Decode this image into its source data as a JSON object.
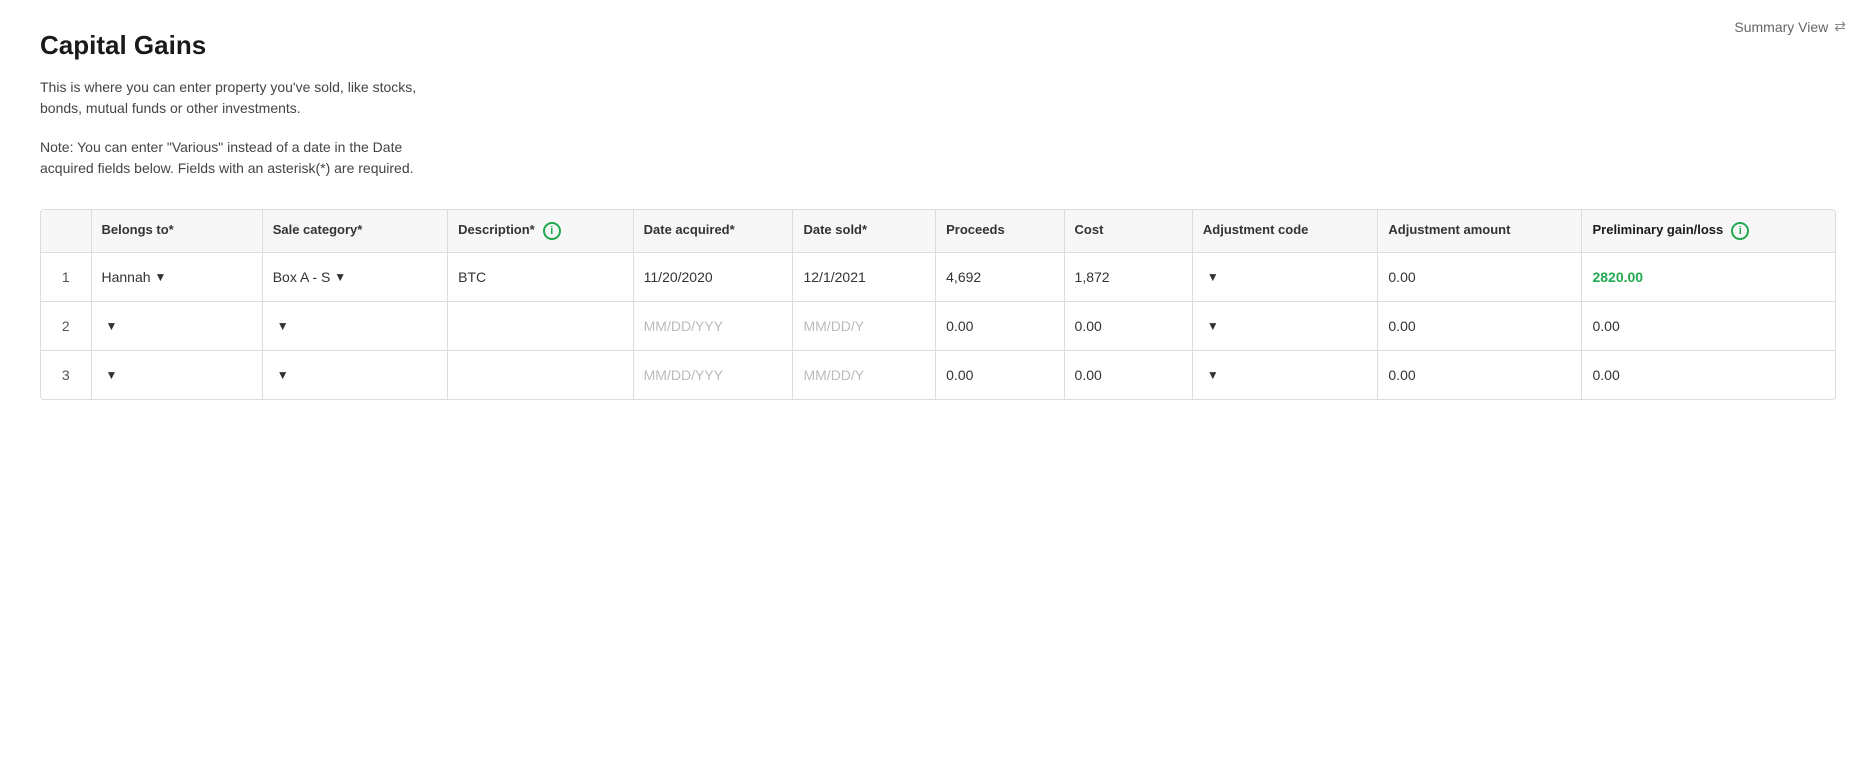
{
  "header": {
    "title": "Capital Gains",
    "summary_view_label": "Summary View"
  },
  "description": {
    "line1": "This is where you can enter property you've sold, like stocks,",
    "line2": "bonds, mutual funds or other investments."
  },
  "note": {
    "line1": "Note: You can enter \"Various\" instead of a date in the Date",
    "line2": "acquired fields below. Fields with an asterisk(*) are required."
  },
  "table": {
    "columns": [
      {
        "key": "num",
        "label": "",
        "required": false
      },
      {
        "key": "belongs_to",
        "label": "Belongs to*",
        "required": false
      },
      {
        "key": "sale_category",
        "label": "Sale category*",
        "required": false
      },
      {
        "key": "description",
        "label": "Description*",
        "required": false,
        "info": true
      },
      {
        "key": "date_acquired",
        "label": "Date acquired*",
        "required": false
      },
      {
        "key": "date_sold",
        "label": "Date sold*",
        "required": false
      },
      {
        "key": "proceeds",
        "label": "Proceeds",
        "required": false
      },
      {
        "key": "cost",
        "label": "Cost",
        "required": false
      },
      {
        "key": "adjustment_code",
        "label": "Adjustment code",
        "required": false
      },
      {
        "key": "adjustment_amount",
        "label": "Adjustment amount",
        "required": false
      },
      {
        "key": "preliminary",
        "label": "Preliminary gain/loss",
        "required": false,
        "info": true,
        "bold": true
      }
    ],
    "rows": [
      {
        "num": "1",
        "belongs_to": "Hannah",
        "belongs_to_dropdown": true,
        "sale_category": "Box A - S",
        "sale_category_dropdown": true,
        "description": "BTC",
        "date_acquired": "11/20/2020",
        "date_sold": "12/1/2021",
        "proceeds": "4,692",
        "cost": "1,872",
        "adjustment_code_dropdown": true,
        "adjustment_amount": "0.00",
        "preliminary": "2820.00",
        "preliminary_gain": true
      },
      {
        "num": "2",
        "belongs_to": "",
        "belongs_to_dropdown": true,
        "sale_category": "",
        "sale_category_dropdown": true,
        "description": "",
        "date_acquired": "MM/DD/YYY",
        "date_acquired_placeholder": true,
        "date_sold": "MM/DD/Y",
        "date_sold_placeholder": true,
        "proceeds": "0.00",
        "cost": "0.00",
        "adjustment_code_dropdown": true,
        "adjustment_amount": "0.00",
        "preliminary": "0.00",
        "preliminary_gain": false
      },
      {
        "num": "3",
        "belongs_to": "",
        "belongs_to_dropdown": true,
        "sale_category": "",
        "sale_category_dropdown": true,
        "description": "",
        "date_acquired": "MM/DD/YYY",
        "date_acquired_placeholder": true,
        "date_sold": "MM/DD/Y",
        "date_sold_placeholder": true,
        "proceeds": "0.00",
        "cost": "0.00",
        "adjustment_code_dropdown": true,
        "adjustment_amount": "0.00",
        "preliminary": "0.00",
        "preliminary_gain": false
      }
    ]
  }
}
